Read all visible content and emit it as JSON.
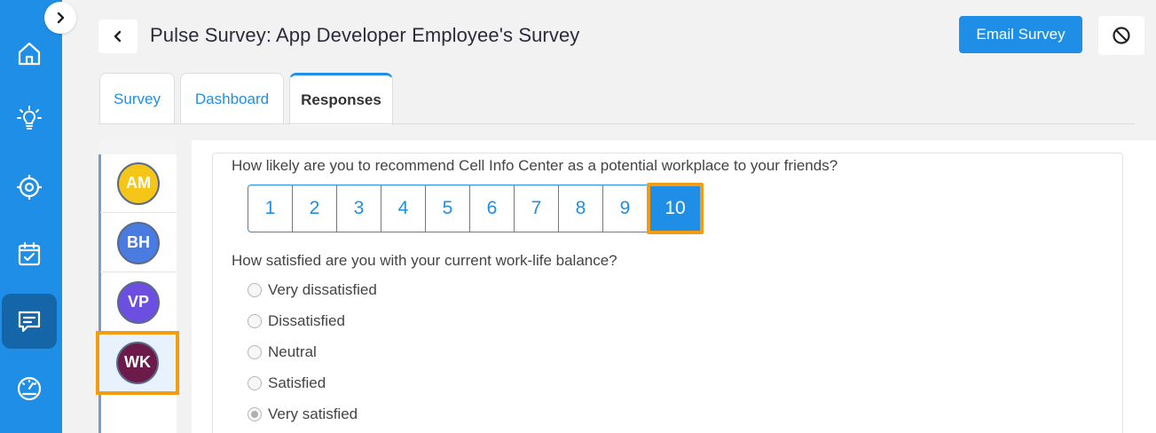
{
  "header": {
    "title": "Pulse Survey: App Developer Employee's Survey",
    "email_button": "Email Survey"
  },
  "sidebar": {
    "items": [
      {
        "icon": "home-icon"
      },
      {
        "icon": "lightbulb-icon"
      },
      {
        "icon": "target-icon"
      },
      {
        "icon": "calendar-check-icon"
      },
      {
        "icon": "chat-icon",
        "active": true
      },
      {
        "icon": "speedometer-icon"
      }
    ]
  },
  "tabs": [
    {
      "label": "Survey"
    },
    {
      "label": "Dashboard"
    },
    {
      "label": "Responses",
      "active": true
    }
  ],
  "respondents": [
    {
      "initials": "AM",
      "color": "#f5c518"
    },
    {
      "initials": "BH",
      "color": "#4a7be0"
    },
    {
      "initials": "VP",
      "color": "#6c4fe0"
    },
    {
      "initials": "WK",
      "color": "#6b1a4a",
      "selected": true
    }
  ],
  "questions": {
    "q1": {
      "text": "How likely are you to recommend Cell Info Center as a potential workplace to your friends?",
      "scale": [
        "1",
        "2",
        "3",
        "4",
        "5",
        "6",
        "7",
        "8",
        "9",
        "10"
      ],
      "selected": "10"
    },
    "q2": {
      "text": "How satisfied are you with your current work-life balance?",
      "options": [
        "Very dissatisfied",
        "Dissatisfied",
        "Neutral",
        "Satisfied",
        "Very satisfied"
      ],
      "selected": "Very satisfied"
    }
  },
  "colors": {
    "accent": "#1f8ee6",
    "highlight": "#f39c12"
  }
}
